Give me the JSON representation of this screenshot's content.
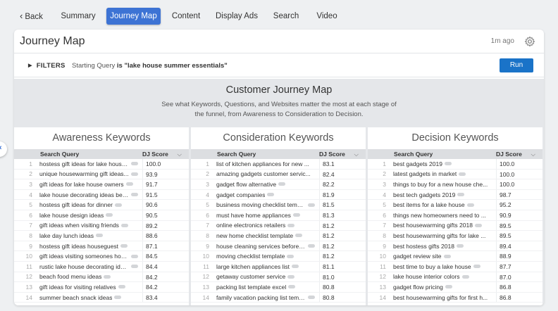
{
  "nav": {
    "back": "Back",
    "tabs": [
      "Summary",
      "Journey Map",
      "Content",
      "Display Ads",
      "Search",
      "Video"
    ],
    "active": "Journey Map"
  },
  "card": {
    "title": "Journey Map",
    "time_ago": "1m ago",
    "icon": "gear-icon"
  },
  "filterbar": {
    "filters_label": "FILTERS",
    "starting_query_prefix": "Starting Query",
    "starting_query_is": "is",
    "starting_query_value": "\"lake house summer essentials\"",
    "run_label": "Run"
  },
  "journey": {
    "title": "Customer Journey Map",
    "description": "See what Keywords, Questions, and Websites matter the most at each stage of the funnel, from Awareness to Consideration to Decision."
  },
  "columns": [
    {
      "title": "Awareness Keywords",
      "header_query": "Search Query",
      "header_score": "DJ Score",
      "rows": [
        {
          "n": "1",
          "q": "hostess gift ideas for lake house...",
          "s": "100.0",
          "pill": true
        },
        {
          "n": "2",
          "q": "unique housewarming gift ideas...",
          "s": "93.9",
          "pill": true
        },
        {
          "n": "3",
          "q": "gift ideas for lake house owners",
          "s": "91.7",
          "pill": true
        },
        {
          "n": "4",
          "q": "lake house decorating ideas bedr...",
          "s": "91.5",
          "pill": true
        },
        {
          "n": "5",
          "q": "hostess gift ideas for dinner",
          "s": "90.6",
          "pill": true
        },
        {
          "n": "6",
          "q": "lake house design ideas",
          "s": "90.5",
          "pill": true
        },
        {
          "n": "7",
          "q": "gift ideas when visiting friends",
          "s": "89.2",
          "pill": true
        },
        {
          "n": "8",
          "q": "lake day lunch ideas",
          "s": "88.6",
          "pill": true
        },
        {
          "n": "9",
          "q": "hostess gift ideas houseguest",
          "s": "87.1",
          "pill": true
        },
        {
          "n": "10",
          "q": "gift ideas visiting someones hom...",
          "s": "84.5",
          "pill": true
        },
        {
          "n": "11",
          "q": "rustic lake house decorating idea...",
          "s": "84.4",
          "pill": true
        },
        {
          "n": "12",
          "q": "beach food menu ideas",
          "s": "84.2",
          "pill": true
        },
        {
          "n": "13",
          "q": "gift ideas for visiting relatives",
          "s": "84.2",
          "pill": true
        },
        {
          "n": "14",
          "q": "summer beach snack ideas",
          "s": "83.4",
          "pill": true
        }
      ]
    },
    {
      "title": "Consideration Keywords",
      "header_query": "Search Query",
      "header_score": "DJ Score",
      "rows": [
        {
          "n": "1",
          "q": "list of kitchen appliances for new ...",
          "s": "83.1",
          "pill": false
        },
        {
          "n": "2",
          "q": "amazing gadgets customer servic...",
          "s": "82.4",
          "pill": false
        },
        {
          "n": "3",
          "q": "gadget flow alternative",
          "s": "82.2",
          "pill": true
        },
        {
          "n": "4",
          "q": "gadget companies",
          "s": "81.9",
          "pill": true
        },
        {
          "n": "5",
          "q": "business moving checklist templa...",
          "s": "81.5",
          "pill": true
        },
        {
          "n": "6",
          "q": "must have home appliances",
          "s": "81.3",
          "pill": true
        },
        {
          "n": "7",
          "q": "online electronics retailers",
          "s": "81.2",
          "pill": true
        },
        {
          "n": "8",
          "q": "new home checklist template",
          "s": "81.2",
          "pill": true
        },
        {
          "n": "9",
          "q": "house cleaning services before m...",
          "s": "81.2",
          "pill": true
        },
        {
          "n": "10",
          "q": "moving checklist template",
          "s": "81.2",
          "pill": true
        },
        {
          "n": "11",
          "q": "large kitchen appliances list",
          "s": "81.1",
          "pill": true
        },
        {
          "n": "12",
          "q": "getaway customer service",
          "s": "81.0",
          "pill": true
        },
        {
          "n": "13",
          "q": "packing list template excel",
          "s": "80.8",
          "pill": true
        },
        {
          "n": "14",
          "q": "family vacation packing list templ...",
          "s": "80.8",
          "pill": true
        }
      ]
    },
    {
      "title": "Decision Keywords",
      "header_query": "Search Query",
      "header_score": "DJ Score",
      "rows": [
        {
          "n": "1",
          "q": "best gadgets 2019",
          "s": "100.0",
          "pill": true
        },
        {
          "n": "2",
          "q": "latest gadgets in market",
          "s": "100.0",
          "pill": true
        },
        {
          "n": "3",
          "q": "things to buy for a new house che...",
          "s": "100.0",
          "pill": false
        },
        {
          "n": "4",
          "q": "best tech gadgets 2019",
          "s": "98.7",
          "pill": true
        },
        {
          "n": "5",
          "q": "best items for a lake house",
          "s": "95.2",
          "pill": true
        },
        {
          "n": "6",
          "q": "things new homeowners need to ...",
          "s": "90.9",
          "pill": false
        },
        {
          "n": "7",
          "q": "best housewarming gifts 2018",
          "s": "89.5",
          "pill": true
        },
        {
          "n": "8",
          "q": "best housewarming gifts for lake ...",
          "s": "89.5",
          "pill": false
        },
        {
          "n": "9",
          "q": "best hostess gifts 2018",
          "s": "89.4",
          "pill": true
        },
        {
          "n": "10",
          "q": "gadget review site",
          "s": "88.9",
          "pill": true
        },
        {
          "n": "11",
          "q": "best time to buy a lake house",
          "s": "87.7",
          "pill": true
        },
        {
          "n": "12",
          "q": "lake house interior colors",
          "s": "87.0",
          "pill": true
        },
        {
          "n": "13",
          "q": "gadget flow pricing",
          "s": "86.8",
          "pill": true
        },
        {
          "n": "14",
          "q": "best housewarming gifts for first h...",
          "s": "86.8",
          "pill": false
        }
      ]
    }
  ]
}
